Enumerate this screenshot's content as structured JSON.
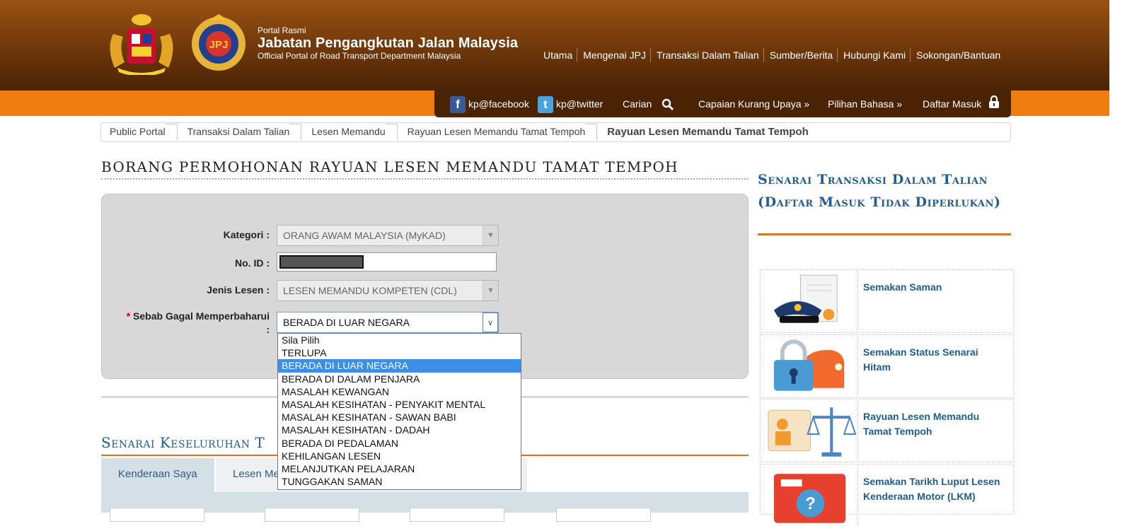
{
  "header": {
    "portal_small": "Portal Rasmi",
    "portal_name": "Jabatan Pengangkutan Jalan Malaysia",
    "portal_sub": "Official Portal of Road Transport Department Malaysia",
    "nav": [
      "Utama",
      "Mengenai JPJ",
      "Transaksi Dalam Talian",
      "Sumber/Berita",
      "Hubungi Kami",
      "Sokongan/Bantuan"
    ]
  },
  "util_bar": {
    "facebook": "kp@facebook",
    "twitter": "kp@twitter",
    "search": "Carian",
    "accessibility": "Capaian Kurang Upaya »",
    "language": "Pilihan Bahasa »",
    "login": "Daftar Masuk"
  },
  "breadcrumb": [
    "Public Portal",
    "Transaksi Dalam Talian",
    "Lesen Memandu",
    "Rayuan Lesen Memandu Tamat Tempoh",
    "Rayuan Lesen Memandu Tamat Tempoh"
  ],
  "form": {
    "title": "BORANG PERMOHONAN RAYUAN LESEN MEMANDU TAMAT TEMPOH",
    "kategori_label": "Kategori :",
    "kategori_value": "ORANG AWAM MALAYSIA (MyKAD)",
    "noid_label": "No. ID :",
    "jenis_label": "Jenis Lesen :",
    "jenis_value": "LESEN MEMANDU KOMPETEN (CDL)",
    "required_mark": "*",
    "sebab_label": "Sebab Gagal Memperbaharui",
    "sebab_colon": ":",
    "sebab_value": "BERADA DI LUAR NEGARA",
    "sebab_options": [
      "Sila Pilih",
      "TERLUPA",
      "BERADA DI LUAR NEGARA",
      "BERADA DI DALAM PENJARA",
      "MASALAH KEWANGAN",
      "MASALAH KESIHATAN - PENYAKIT MENTAL",
      "MASALAH KESIHATAN - SAWAN BABI",
      "MASALAH KESIHATAN - DADAH",
      "BERADA DI PEDALAMAN",
      "KEHILANGAN LESEN",
      "MELANJUTKAN PELAJARAN",
      "TUNGGAKAN SAMAN"
    ],
    "highlighted_option": "BERADA DI LUAR NEGARA"
  },
  "section": {
    "title": "Senarai Keseluruhan T",
    "tabs": [
      "Kenderaan Saya",
      "Lesen Me"
    ]
  },
  "sidebar": {
    "title": "Senarai Transaksi Dalam Talian (Daftar Masuk Tidak Diperlukan)",
    "items": [
      "Semakan Saman",
      "Semakan Status Senarai Hitam",
      "Rayuan Lesen Memandu Tamat Tempoh",
      "Semakan Tarikh Luput Lesen Kenderaan Motor (LKM)"
    ]
  },
  "colors": {
    "header_brown": "#7a3e0c",
    "accent_orange": "#f07d0f",
    "link_blue": "#1f5d8f",
    "highlight_blue": "#3d8ee6"
  }
}
